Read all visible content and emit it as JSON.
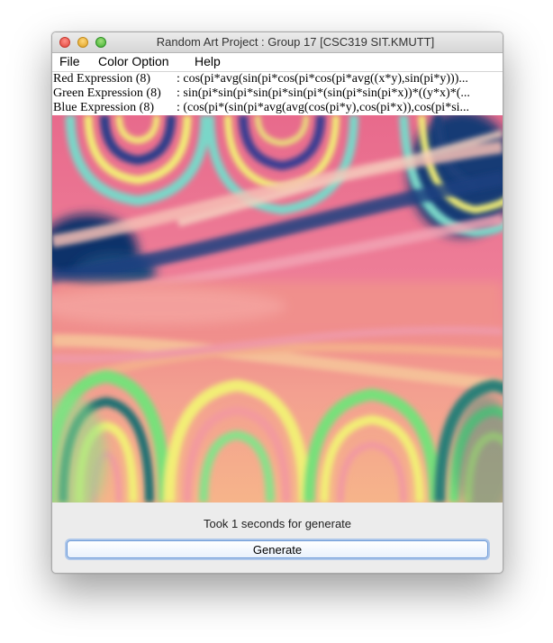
{
  "window": {
    "title": "Random Art Project : Group 17 [CSC319 SIT.KMUTT]"
  },
  "menu": {
    "items": [
      "File",
      "Color Option",
      "Help"
    ]
  },
  "expressions": {
    "red": {
      "label": "Red Expression (8)",
      "value": ": cos(pi*avg(sin(pi*cos(pi*cos(pi*avg((x*y),sin(pi*y)))..."
    },
    "green": {
      "label": "Green Expression (8)",
      "value": ": sin(pi*sin(pi*sin(pi*sin(pi*(sin(pi*sin(pi*x))*((y*x)*(..."
    },
    "blue": {
      "label": "Blue Expression (8)",
      "value": ": (cos(pi*(sin(pi*avg(avg(cos(pi*y),cos(pi*x)),cos(pi*si..."
    }
  },
  "status": "Took 1 seconds for generate",
  "generate_label": "Generate",
  "colors": {
    "pink": "#e86a8c",
    "salmon": "#f08c8c",
    "navy": "#102e6e",
    "yellow": "#f2ee76",
    "green": "#78e07a"
  }
}
